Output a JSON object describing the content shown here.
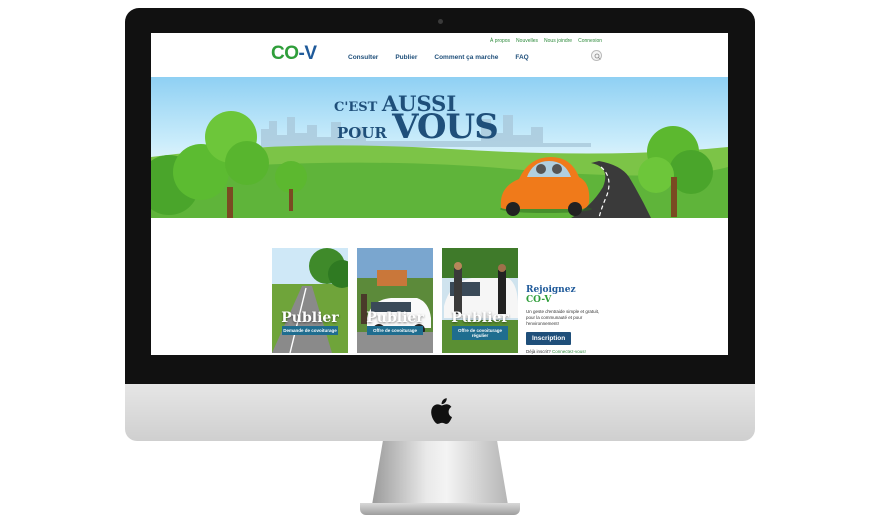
{
  "site": {
    "logo": {
      "brand_left": "CO",
      "brand_dash": "-",
      "brand_right": "V"
    },
    "utility_links": [
      "À propos",
      "Nouvelles",
      "Nous joindre",
      "Connexion"
    ],
    "nav": [
      "Consulter",
      "Publier",
      "Comment ça marche",
      "FAQ"
    ],
    "search_icon": "search-icon",
    "hero": {
      "line1_prefix": "C'EST",
      "line1_big": "AUSSI",
      "line2_prefix": "POUR",
      "line2_big": "VOUS"
    },
    "cards": [
      {
        "title": "Publier",
        "subtitle": "Demande de covoiturage"
      },
      {
        "title": "Publier",
        "subtitle": "Offre de covoiturage"
      },
      {
        "title": "Publier",
        "subtitle": "Offre de covoiturage régulier"
      }
    ],
    "join": {
      "title": "Rejoignez",
      "brand": "CO-V",
      "text": "Un geste d'entraide simple et gratuit, pour la communauté et pour l'environnement!",
      "button": "Inscription",
      "login_prefix": "Déjà inscrit?",
      "login_link": "Connectez-vous!"
    },
    "colors": {
      "green": "#2f9e3a",
      "blue": "#1f4f7a",
      "teal": "#1f6d8f"
    }
  },
  "device": {
    "logo_icon": "apple-logo-icon"
  }
}
